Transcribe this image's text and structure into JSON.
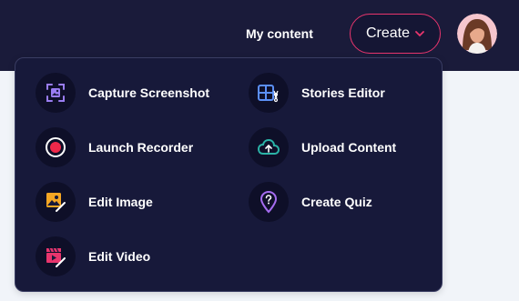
{
  "header": {
    "nav_link": "My content",
    "create_label": "Create"
  },
  "menu": {
    "items": [
      {
        "label": "Capture Screenshot",
        "icon": "capture-screenshot-icon"
      },
      {
        "label": "Stories Editor",
        "icon": "stories-editor-icon"
      },
      {
        "label": "Launch Recorder",
        "icon": "record-icon"
      },
      {
        "label": "Upload Content",
        "icon": "upload-cloud-icon"
      },
      {
        "label": "Edit Image",
        "icon": "edit-image-icon"
      },
      {
        "label": "Create Quiz",
        "icon": "quiz-icon"
      },
      {
        "label": "Edit Video",
        "icon": "edit-video-icon"
      }
    ]
  },
  "colors": {
    "header_bg": "#1a1b3a",
    "menu_bg": "#17193a",
    "accent_pink": "#e8356d",
    "page_bg": "#f1f4f9"
  }
}
